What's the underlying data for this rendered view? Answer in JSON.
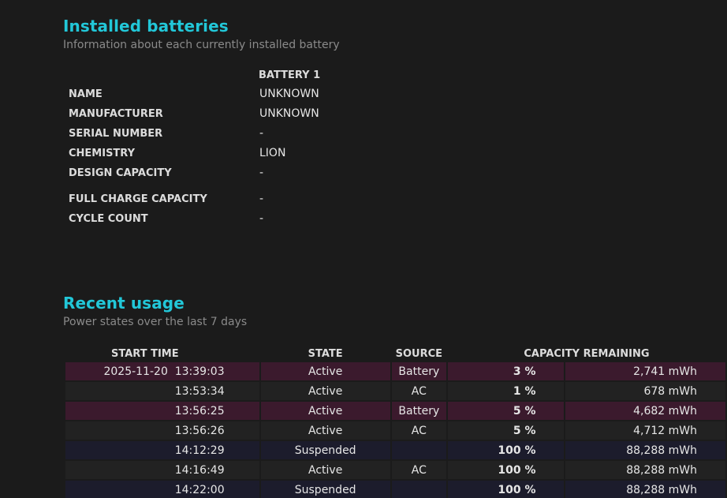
{
  "installed": {
    "title": "Installed batteries",
    "subtitle": "Information about each currently installed battery",
    "column_header": "BATTERY 1",
    "rows": [
      {
        "label": "NAME",
        "value": "UNKNOWN"
      },
      {
        "label": "MANUFACTURER",
        "value": "UNKNOWN"
      },
      {
        "label": "SERIAL NUMBER",
        "value": "-"
      },
      {
        "label": "CHEMISTRY",
        "value": "LION"
      },
      {
        "label": "DESIGN CAPACITY",
        "value": "-"
      },
      {
        "label": "FULL CHARGE CAPACITY",
        "value": "-"
      },
      {
        "label": "CYCLE COUNT",
        "value": "-"
      }
    ]
  },
  "recent": {
    "title": "Recent usage",
    "subtitle": "Power states over the last 7 days",
    "headers": {
      "start_time": "START TIME",
      "state": "STATE",
      "source": "SOURCE",
      "capacity": "CAPACITY REMAINING"
    },
    "rows": [
      {
        "time": "2025-11-20  13:39:03",
        "state": "Active",
        "source": "Battery",
        "pct": "3 %",
        "mwh": "2,741 mWh",
        "kind": "battery"
      },
      {
        "time": "13:53:34",
        "state": "Active",
        "source": "AC",
        "pct": "1 %",
        "mwh": "678 mWh",
        "kind": "ac"
      },
      {
        "time": "13:56:25",
        "state": "Active",
        "source": "Battery",
        "pct": "5 %",
        "mwh": "4,682 mWh",
        "kind": "battery"
      },
      {
        "time": "13:56:26",
        "state": "Active",
        "source": "AC",
        "pct": "5 %",
        "mwh": "4,712 mWh",
        "kind": "ac"
      },
      {
        "time": "14:12:29",
        "state": "Suspended",
        "source": "",
        "pct": "100 %",
        "mwh": "88,288 mWh",
        "kind": "suspended"
      },
      {
        "time": "14:16:49",
        "state": "Active",
        "source": "AC",
        "pct": "100 %",
        "mwh": "88,288 mWh",
        "kind": "ac"
      },
      {
        "time": "14:22:00",
        "state": "Suspended",
        "source": "",
        "pct": "100 %",
        "mwh": "88,288 mWh",
        "kind": "suspended"
      }
    ]
  },
  "colors": {
    "title": "#22c7d8",
    "battery_row": "#3b1a2d",
    "ac_row": "#222222",
    "suspended_row": "#1c1c2c"
  }
}
